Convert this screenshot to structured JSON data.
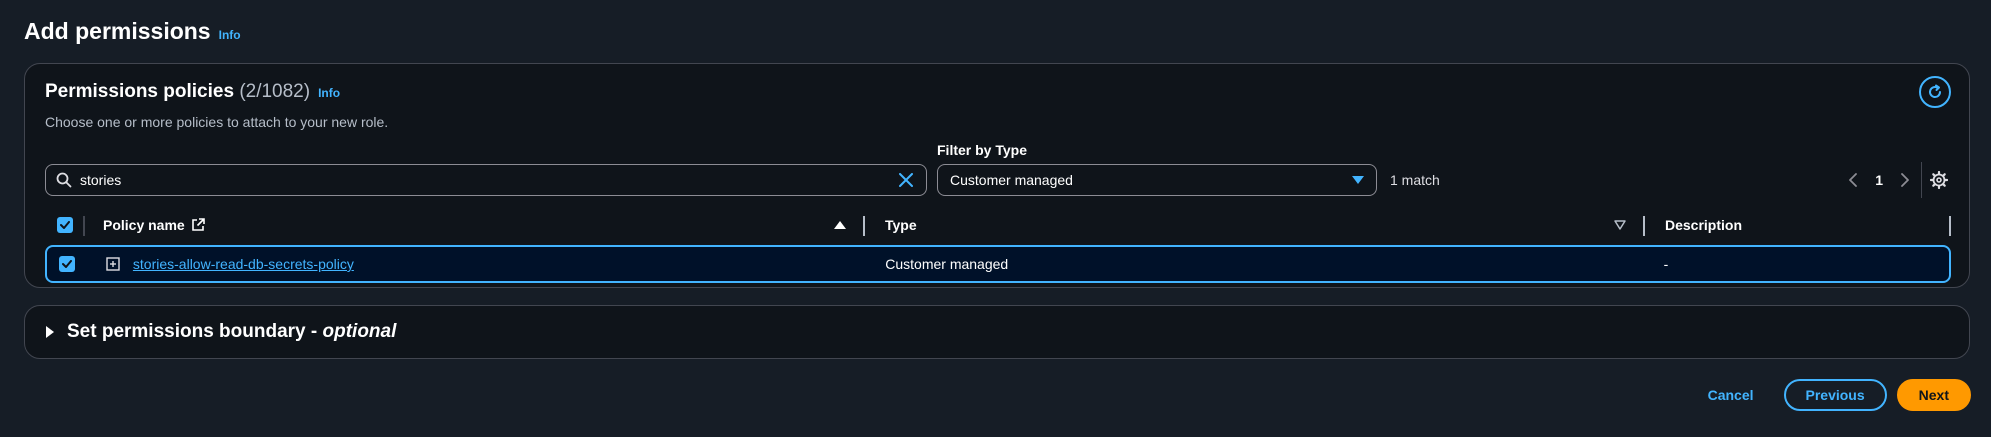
{
  "header": {
    "title": "Add permissions",
    "info": "Info"
  },
  "policies": {
    "title": "Permissions policies",
    "count": "(2/1082)",
    "info": "Info",
    "description": "Choose one or more policies to attach to your new role.",
    "search_value": "stories",
    "filter_label": "Filter by Type",
    "filter_value": "Customer managed",
    "match_text": "1 match",
    "page_number": "1",
    "columns": {
      "name": "Policy name",
      "type": "Type",
      "description": "Description"
    },
    "rows": [
      {
        "name": "stories-allow-read-db-secrets-policy",
        "type": "Customer managed",
        "description": "-"
      }
    ]
  },
  "boundary": {
    "title": "Set permissions boundary - ",
    "optional": "optional"
  },
  "footer": {
    "cancel": "Cancel",
    "previous": "Previous",
    "next": "Next"
  },
  "icons": {
    "refresh": "refresh-icon",
    "search": "search-icon",
    "clear": "close-icon",
    "caret": "caret-down-icon",
    "external": "external-link-icon",
    "settings": "gear-icon"
  },
  "colors": {
    "accent": "#42b4ff",
    "primary_button": "#ff9900",
    "background": "#161d26",
    "panel": "#0f141a"
  }
}
